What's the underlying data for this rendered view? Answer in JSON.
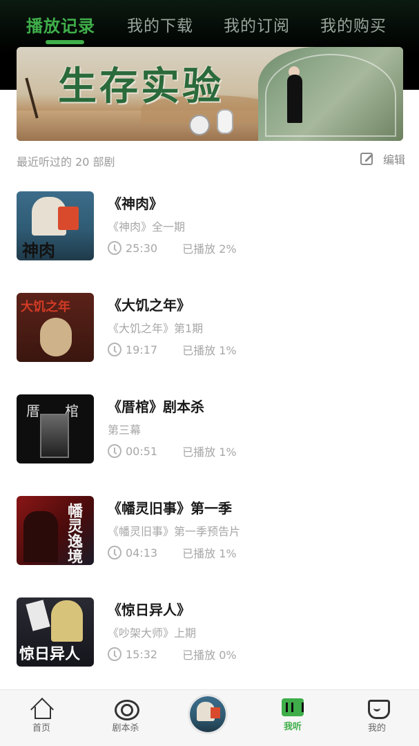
{
  "tabs": [
    {
      "label": "播放记录",
      "active": true
    },
    {
      "label": "我的下载",
      "active": false
    },
    {
      "label": "我的订阅",
      "active": false
    },
    {
      "label": "我的购买",
      "active": false
    }
  ],
  "banner": {
    "title": "生存实验"
  },
  "section": {
    "recent_label": "最近听过的 20 部剧",
    "edit_label": "编辑"
  },
  "items": [
    {
      "title": "《神肉》",
      "subtitle": "《神肉》全一期",
      "duration": "25:30",
      "played": "已播放 2%",
      "cover_text": "神肉"
    },
    {
      "title": "《大饥之年》",
      "subtitle": "《大饥之年》第1期",
      "duration": "19:17",
      "played": "已播放 1%",
      "cover_text": "大饥之年"
    },
    {
      "title": "《厝棺》剧本杀",
      "subtitle": "第三幕",
      "duration": "00:51",
      "played": "已播放 1%",
      "cover_text_left": "厝",
      "cover_text_right": "棺"
    },
    {
      "title": "《幡灵旧事》第一季",
      "subtitle": "《幡灵旧事》第一季预告片",
      "duration": "04:13",
      "played": "已播放 1%",
      "cover_text": "幡灵逸境"
    },
    {
      "title": "《惊日异人》",
      "subtitle": "《吵架大师》上期",
      "duration": "15:32",
      "played": "已播放 0%",
      "cover_text": "惊日异人"
    }
  ],
  "nav": [
    {
      "label": "首页",
      "icon": "home-icon",
      "active": false
    },
    {
      "label": "剧本杀",
      "icon": "target-icon",
      "active": false
    },
    {
      "label": "",
      "icon": "now-playing-cover",
      "active": false
    },
    {
      "label": "我听",
      "icon": "listen-icon",
      "active": true
    },
    {
      "label": "我的",
      "icon": "me-icon",
      "active": false
    }
  ],
  "colors": {
    "accent": "#3fae4a",
    "header_bg": "#000000",
    "text_muted": "#a7a7a7"
  }
}
